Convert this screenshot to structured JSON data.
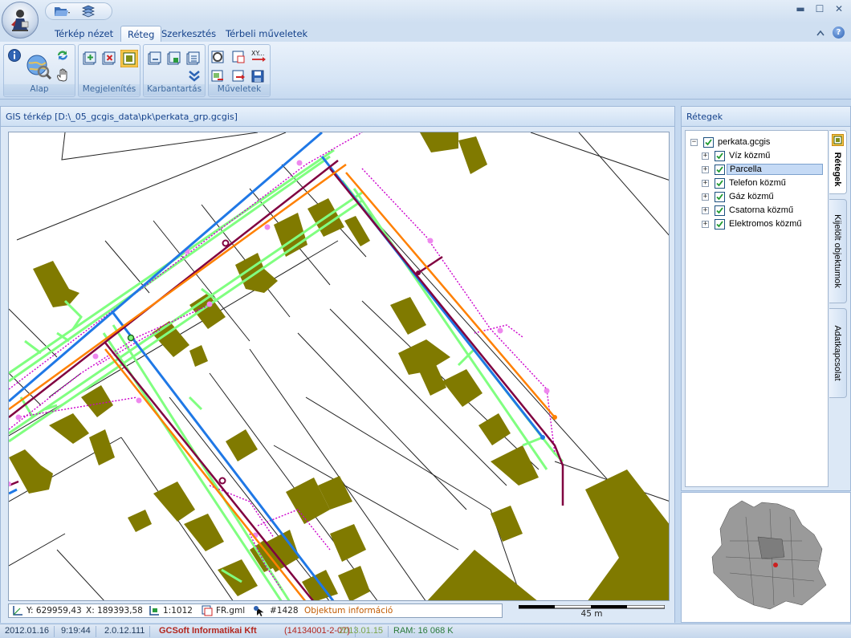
{
  "quick_access": {
    "open_icon": "folder-open-icon",
    "layers_icon": "layers-stack-icon"
  },
  "window_controls": [
    "▬",
    "☐",
    "✕"
  ],
  "tabs": [
    {
      "label": "Térkép nézet"
    },
    {
      "label": "Réteg"
    },
    {
      "label": "Szerkesztés"
    },
    {
      "label": "Térbeli műveletek"
    }
  ],
  "ribbon": {
    "groups": [
      {
        "label": "Alap"
      },
      {
        "label": "Megjelenítés"
      },
      {
        "label": "Karbantartás"
      },
      {
        "label": "Műveletek"
      }
    ],
    "xy_label": "XY..."
  },
  "map": {
    "title": "GIS térkép [D:\\_05_gcgis_data\\pk\\perkata_grp.gcgis]",
    "status": {
      "y": "Y: 629959,43",
      "x": "X: 189393,58",
      "scale": "1:1012",
      "file": "FR.gml",
      "object_id": "#1428",
      "info": "Objektum információ"
    },
    "scale_bar_label": "45 m",
    "colors": {
      "building": "#807a00",
      "water": "#1f78e6",
      "parcel": "#222222",
      "telephone": "#ff8000",
      "gas": "#800040",
      "sewer": "#80ff80",
      "electric": "#cc00cc"
    }
  },
  "layers": {
    "header": "Rétegek",
    "root": "perkata.gcgis",
    "items": [
      {
        "label": "Víz közmű"
      },
      {
        "label": "Parcella"
      },
      {
        "label": "Telefon közmű"
      },
      {
        "label": "Gáz közmű"
      },
      {
        "label": "Csatorna közmű"
      },
      {
        "label": "Elektromos közmű"
      }
    ],
    "side_tabs": [
      "Rétegek",
      "Kijelölt objektumok",
      "Adatkapcsolat"
    ]
  },
  "statusbar": {
    "date": "2012.01.16",
    "time": "9:19:44",
    "version": "2.0.12.111",
    "company": "GCSoft Informatikai Kft",
    "license": "(14134001-2-07)",
    "build_date": "2013.01.15",
    "ram": "RAM: 16 068 K"
  }
}
